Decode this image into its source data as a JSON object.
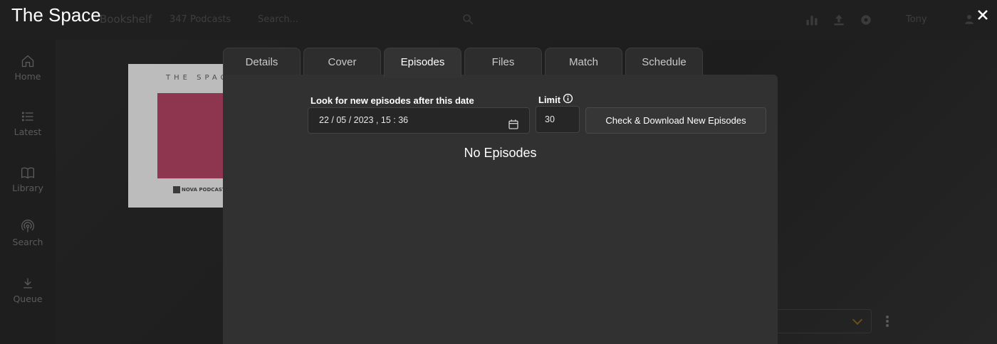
{
  "modal": {
    "title": "The Space",
    "tabs": [
      {
        "label": "Details"
      },
      {
        "label": "Cover"
      },
      {
        "label": "Episodes",
        "active": true
      },
      {
        "label": "Files"
      },
      {
        "label": "Match"
      },
      {
        "label": "Schedule"
      }
    ],
    "episodes": {
      "date_label": "Look for new episodes after this date",
      "date_value": "22 / 05 / 2023 ,  15 : 36",
      "limit_label": "Limit",
      "limit_value": "30",
      "check_button": "Check & Download New Episodes",
      "empty_text": "No Episodes"
    }
  },
  "background": {
    "topbar": {
      "app_name": "Bookshelf",
      "selection_count": "347 Podcasts",
      "search_placeholder": "Search...",
      "username": "Tony"
    },
    "sidebar": [
      {
        "label": "Home",
        "icon": "home-icon"
      },
      {
        "label": "Latest",
        "icon": "list-icon"
      },
      {
        "label": "Library",
        "icon": "book-icon"
      },
      {
        "label": "Search",
        "icon": "podcast-icon"
      },
      {
        "label": "Queue",
        "icon": "download-icon"
      }
    ],
    "cover": {
      "title_text": "THE SPACE",
      "publisher": "NOVA PODCASTS"
    }
  },
  "colors": {
    "modal_panel": "#313131",
    "cover_accent": "#8e3550"
  }
}
